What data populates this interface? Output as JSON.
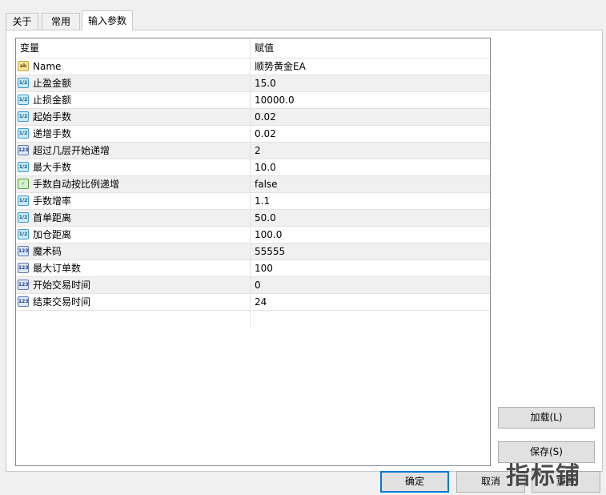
{
  "tabs": [
    {
      "label": "关于"
    },
    {
      "label": "常用"
    },
    {
      "label": "输入参数"
    }
  ],
  "grid": {
    "header_variable": "变量",
    "header_value": "赋值",
    "rows": [
      {
        "type": "string",
        "icon": "string-type-icon",
        "icon_text": "ab",
        "name": "Name",
        "value": "顺势黄金EA"
      },
      {
        "type": "double",
        "icon": "double-type-icon",
        "icon_text": "1/2",
        "name": "止盈金额",
        "value": "15.0"
      },
      {
        "type": "double",
        "icon": "double-type-icon",
        "icon_text": "1/2",
        "name": "止损金额",
        "value": "10000.0"
      },
      {
        "type": "double",
        "icon": "double-type-icon",
        "icon_text": "1/2",
        "name": "起始手数",
        "value": "0.02"
      },
      {
        "type": "double",
        "icon": "double-type-icon",
        "icon_text": "1/2",
        "name": "递增手数",
        "value": "0.02"
      },
      {
        "type": "int",
        "icon": "integer-type-icon",
        "icon_text": "123",
        "name": "超过几层开始递增",
        "value": "2"
      },
      {
        "type": "double",
        "icon": "double-type-icon",
        "icon_text": "1/2",
        "name": "最大手数",
        "value": "10.0"
      },
      {
        "type": "bool",
        "icon": "boolean-type-icon",
        "icon_text": "✓",
        "name": "手数自动按比例递增",
        "value": "false"
      },
      {
        "type": "double",
        "icon": "double-type-icon",
        "icon_text": "1/2",
        "name": "手数增率",
        "value": "1.1"
      },
      {
        "type": "double",
        "icon": "double-type-icon",
        "icon_text": "1/2",
        "name": "首单距离",
        "value": "50.0"
      },
      {
        "type": "double",
        "icon": "double-type-icon",
        "icon_text": "1/2",
        "name": "加仓距离",
        "value": "100.0"
      },
      {
        "type": "int",
        "icon": "integer-type-icon",
        "icon_text": "123",
        "name": "魔术码",
        "value": "55555"
      },
      {
        "type": "int",
        "icon": "integer-type-icon",
        "icon_text": "123",
        "name": "最大订单数",
        "value": "100"
      },
      {
        "type": "int",
        "icon": "integer-type-icon",
        "icon_text": "123",
        "name": "开始交易时间",
        "value": "0"
      },
      {
        "type": "int",
        "icon": "integer-type-icon",
        "icon_text": "123",
        "name": "结束交易时间",
        "value": "24"
      }
    ]
  },
  "buttons": {
    "load": "加载(L)",
    "save": "保存(S)",
    "ok": "确定",
    "cancel": "取消",
    "reset": "重置"
  },
  "watermark": "指标铺",
  "colors": {
    "accent": "#0078d7",
    "row_alt": "#f0f0f0",
    "border": "#828790"
  }
}
